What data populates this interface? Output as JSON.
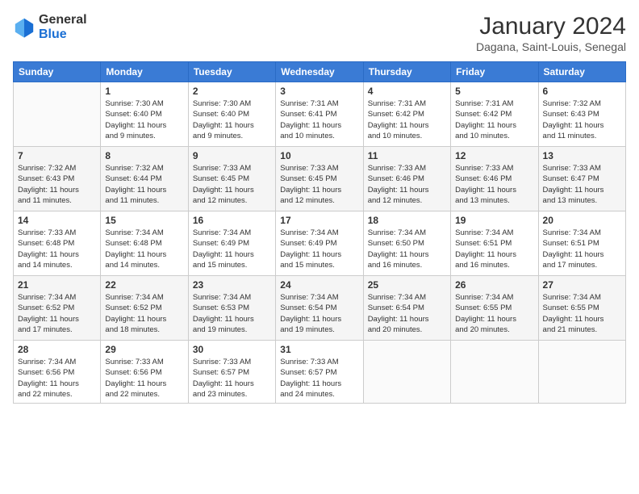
{
  "header": {
    "logo": {
      "general": "General",
      "blue": "Blue"
    },
    "title": "January 2024",
    "subtitle": "Dagana, Saint-Louis, Senegal"
  },
  "days_of_week": [
    "Sunday",
    "Monday",
    "Tuesday",
    "Wednesday",
    "Thursday",
    "Friday",
    "Saturday"
  ],
  "weeks": [
    [
      {
        "day": "",
        "info": ""
      },
      {
        "day": "1",
        "info": "Sunrise: 7:30 AM\nSunset: 6:40 PM\nDaylight: 11 hours\nand 9 minutes."
      },
      {
        "day": "2",
        "info": "Sunrise: 7:30 AM\nSunset: 6:40 PM\nDaylight: 11 hours\nand 9 minutes."
      },
      {
        "day": "3",
        "info": "Sunrise: 7:31 AM\nSunset: 6:41 PM\nDaylight: 11 hours\nand 10 minutes."
      },
      {
        "day": "4",
        "info": "Sunrise: 7:31 AM\nSunset: 6:42 PM\nDaylight: 11 hours\nand 10 minutes."
      },
      {
        "day": "5",
        "info": "Sunrise: 7:31 AM\nSunset: 6:42 PM\nDaylight: 11 hours\nand 10 minutes."
      },
      {
        "day": "6",
        "info": "Sunrise: 7:32 AM\nSunset: 6:43 PM\nDaylight: 11 hours\nand 11 minutes."
      }
    ],
    [
      {
        "day": "7",
        "info": "Sunrise: 7:32 AM\nSunset: 6:43 PM\nDaylight: 11 hours\nand 11 minutes."
      },
      {
        "day": "8",
        "info": "Sunrise: 7:32 AM\nSunset: 6:44 PM\nDaylight: 11 hours\nand 11 minutes."
      },
      {
        "day": "9",
        "info": "Sunrise: 7:33 AM\nSunset: 6:45 PM\nDaylight: 11 hours\nand 12 minutes."
      },
      {
        "day": "10",
        "info": "Sunrise: 7:33 AM\nSunset: 6:45 PM\nDaylight: 11 hours\nand 12 minutes."
      },
      {
        "day": "11",
        "info": "Sunrise: 7:33 AM\nSunset: 6:46 PM\nDaylight: 11 hours\nand 12 minutes."
      },
      {
        "day": "12",
        "info": "Sunrise: 7:33 AM\nSunset: 6:46 PM\nDaylight: 11 hours\nand 13 minutes."
      },
      {
        "day": "13",
        "info": "Sunrise: 7:33 AM\nSunset: 6:47 PM\nDaylight: 11 hours\nand 13 minutes."
      }
    ],
    [
      {
        "day": "14",
        "info": "Sunrise: 7:33 AM\nSunset: 6:48 PM\nDaylight: 11 hours\nand 14 minutes."
      },
      {
        "day": "15",
        "info": "Sunrise: 7:34 AM\nSunset: 6:48 PM\nDaylight: 11 hours\nand 14 minutes."
      },
      {
        "day": "16",
        "info": "Sunrise: 7:34 AM\nSunset: 6:49 PM\nDaylight: 11 hours\nand 15 minutes."
      },
      {
        "day": "17",
        "info": "Sunrise: 7:34 AM\nSunset: 6:49 PM\nDaylight: 11 hours\nand 15 minutes."
      },
      {
        "day": "18",
        "info": "Sunrise: 7:34 AM\nSunset: 6:50 PM\nDaylight: 11 hours\nand 16 minutes."
      },
      {
        "day": "19",
        "info": "Sunrise: 7:34 AM\nSunset: 6:51 PM\nDaylight: 11 hours\nand 16 minutes."
      },
      {
        "day": "20",
        "info": "Sunrise: 7:34 AM\nSunset: 6:51 PM\nDaylight: 11 hours\nand 17 minutes."
      }
    ],
    [
      {
        "day": "21",
        "info": "Sunrise: 7:34 AM\nSunset: 6:52 PM\nDaylight: 11 hours\nand 17 minutes."
      },
      {
        "day": "22",
        "info": "Sunrise: 7:34 AM\nSunset: 6:52 PM\nDaylight: 11 hours\nand 18 minutes."
      },
      {
        "day": "23",
        "info": "Sunrise: 7:34 AM\nSunset: 6:53 PM\nDaylight: 11 hours\nand 19 minutes."
      },
      {
        "day": "24",
        "info": "Sunrise: 7:34 AM\nSunset: 6:54 PM\nDaylight: 11 hours\nand 19 minutes."
      },
      {
        "day": "25",
        "info": "Sunrise: 7:34 AM\nSunset: 6:54 PM\nDaylight: 11 hours\nand 20 minutes."
      },
      {
        "day": "26",
        "info": "Sunrise: 7:34 AM\nSunset: 6:55 PM\nDaylight: 11 hours\nand 20 minutes."
      },
      {
        "day": "27",
        "info": "Sunrise: 7:34 AM\nSunset: 6:55 PM\nDaylight: 11 hours\nand 21 minutes."
      }
    ],
    [
      {
        "day": "28",
        "info": "Sunrise: 7:34 AM\nSunset: 6:56 PM\nDaylight: 11 hours\nand 22 minutes."
      },
      {
        "day": "29",
        "info": "Sunrise: 7:33 AM\nSunset: 6:56 PM\nDaylight: 11 hours\nand 22 minutes."
      },
      {
        "day": "30",
        "info": "Sunrise: 7:33 AM\nSunset: 6:57 PM\nDaylight: 11 hours\nand 23 minutes."
      },
      {
        "day": "31",
        "info": "Sunrise: 7:33 AM\nSunset: 6:57 PM\nDaylight: 11 hours\nand 24 minutes."
      },
      {
        "day": "",
        "info": ""
      },
      {
        "day": "",
        "info": ""
      },
      {
        "day": "",
        "info": ""
      }
    ]
  ]
}
